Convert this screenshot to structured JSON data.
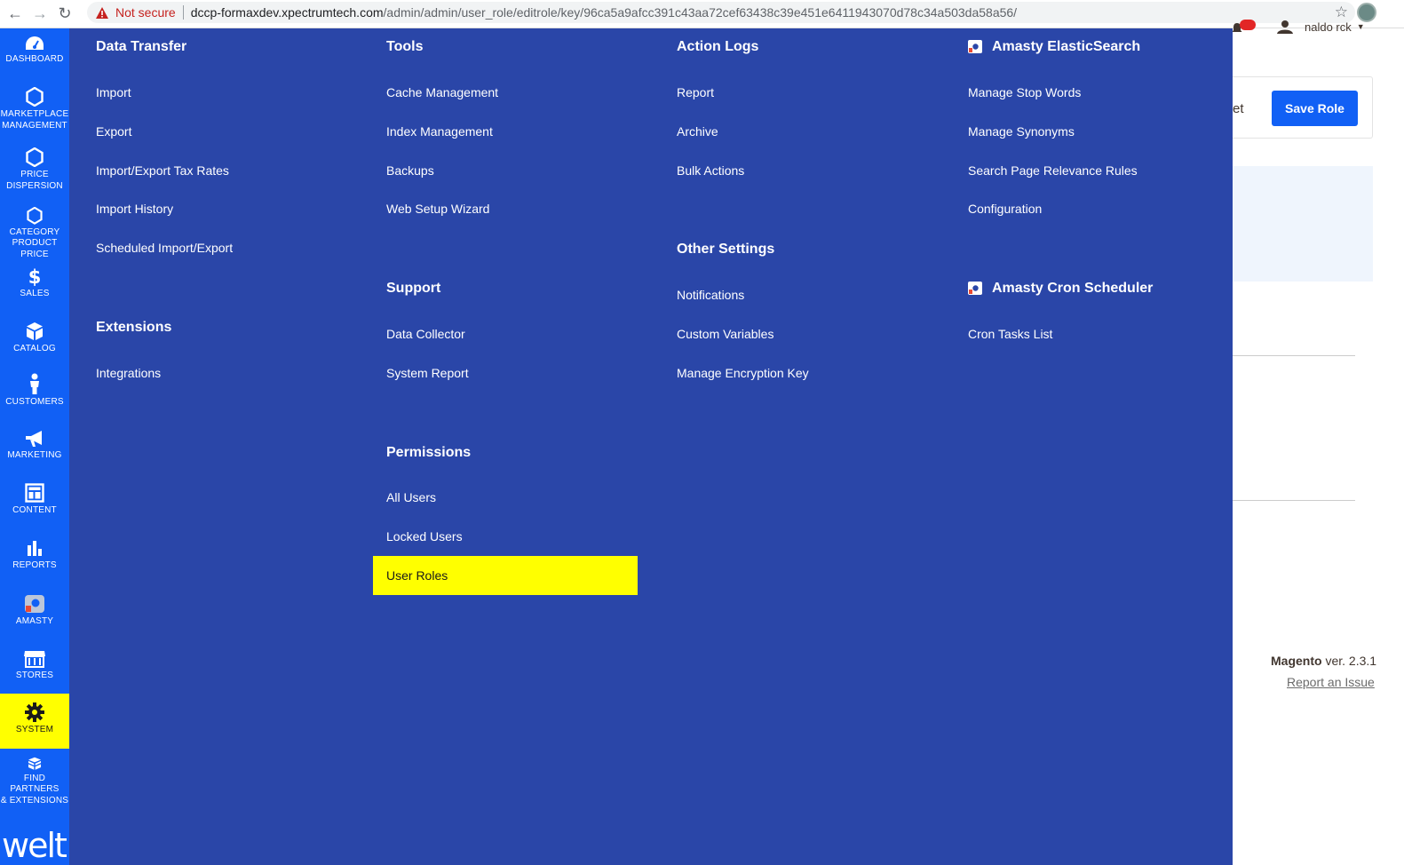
{
  "browser": {
    "not_secure": "Not secure",
    "url_host": "dccp-formaxdev.xpectrumtech.com",
    "url_path": "/admin/admin/user_role/editrole/key/96ca5a9afcc391c43aa72cef63438c39e451e6411943070d78c34a503da58a56/"
  },
  "sidebar": {
    "items": [
      {
        "label": "DASHBOARD",
        "icon": "dashboard-icon"
      },
      {
        "label": "MARKETPLACE\nMANAGEMENT",
        "icon": "hexagon-icon"
      },
      {
        "label": "PRICE\nDISPERSION",
        "icon": "hexagon-icon"
      },
      {
        "label": "CATEGORY\nPRODUCT PRICE",
        "icon": "hexagon-icon"
      },
      {
        "label": "SALES",
        "icon": "dollar-icon"
      },
      {
        "label": "CATALOG",
        "icon": "box-icon"
      },
      {
        "label": "CUSTOMERS",
        "icon": "person-icon"
      },
      {
        "label": "MARKETING",
        "icon": "megaphone-icon"
      },
      {
        "label": "CONTENT",
        "icon": "layout-icon"
      },
      {
        "label": "REPORTS",
        "icon": "bar-chart-icon"
      },
      {
        "label": "AMASTY",
        "icon": "amasty-icon"
      },
      {
        "label": "STORES",
        "icon": "storefront-icon"
      },
      {
        "label": "SYSTEM",
        "icon": "gear-icon"
      },
      {
        "label": "FIND PARTNERS\n& EXTENSIONS",
        "icon": "blocks-icon"
      }
    ],
    "logo": "welt",
    "active": "SYSTEM"
  },
  "flyout": {
    "data_transfer": {
      "title": "Data Transfer",
      "links": [
        "Import",
        "Export",
        "Import/Export Tax Rates",
        "Import History",
        "Scheduled Import/Export"
      ]
    },
    "extensions": {
      "title": "Extensions",
      "links": [
        "Integrations"
      ]
    },
    "tools": {
      "title": "Tools",
      "links": [
        "Cache Management",
        "Index Management",
        "Backups",
        "Web Setup Wizard"
      ]
    },
    "support": {
      "title": "Support",
      "links": [
        "Data Collector",
        "System Report"
      ]
    },
    "permissions": {
      "title": "Permissions",
      "links": [
        "All Users",
        "Locked Users",
        "User Roles"
      ],
      "highlighted": "User Roles"
    },
    "action_logs": {
      "title": "Action Logs",
      "links": [
        "Report",
        "Archive",
        "Bulk Actions"
      ]
    },
    "other_settings": {
      "title": "Other Settings",
      "links": [
        "Notifications",
        "Custom Variables",
        "Manage Encryption Key"
      ]
    },
    "amasty_elastic": {
      "title": "Amasty ElasticSearch",
      "links": [
        "Manage Stop Words",
        "Manage Synonyms",
        "Search Page Relevance Rules",
        "Configuration"
      ]
    },
    "amasty_cron": {
      "title": "Amasty Cron Scheduler",
      "links": [
        "Cron Tasks List"
      ]
    }
  },
  "page": {
    "user_name": "naldo rck",
    "reset_partial": "et",
    "save_role": "Save Role",
    "magento_brand": "Magento",
    "magento_version": "ver. 2.3.1",
    "report_issue": "Report an Issue"
  },
  "colors": {
    "sidebar": "#1160f5",
    "flyout": "#2a46a8",
    "highlight": "#ffff00",
    "primary_button": "#1160f5"
  }
}
